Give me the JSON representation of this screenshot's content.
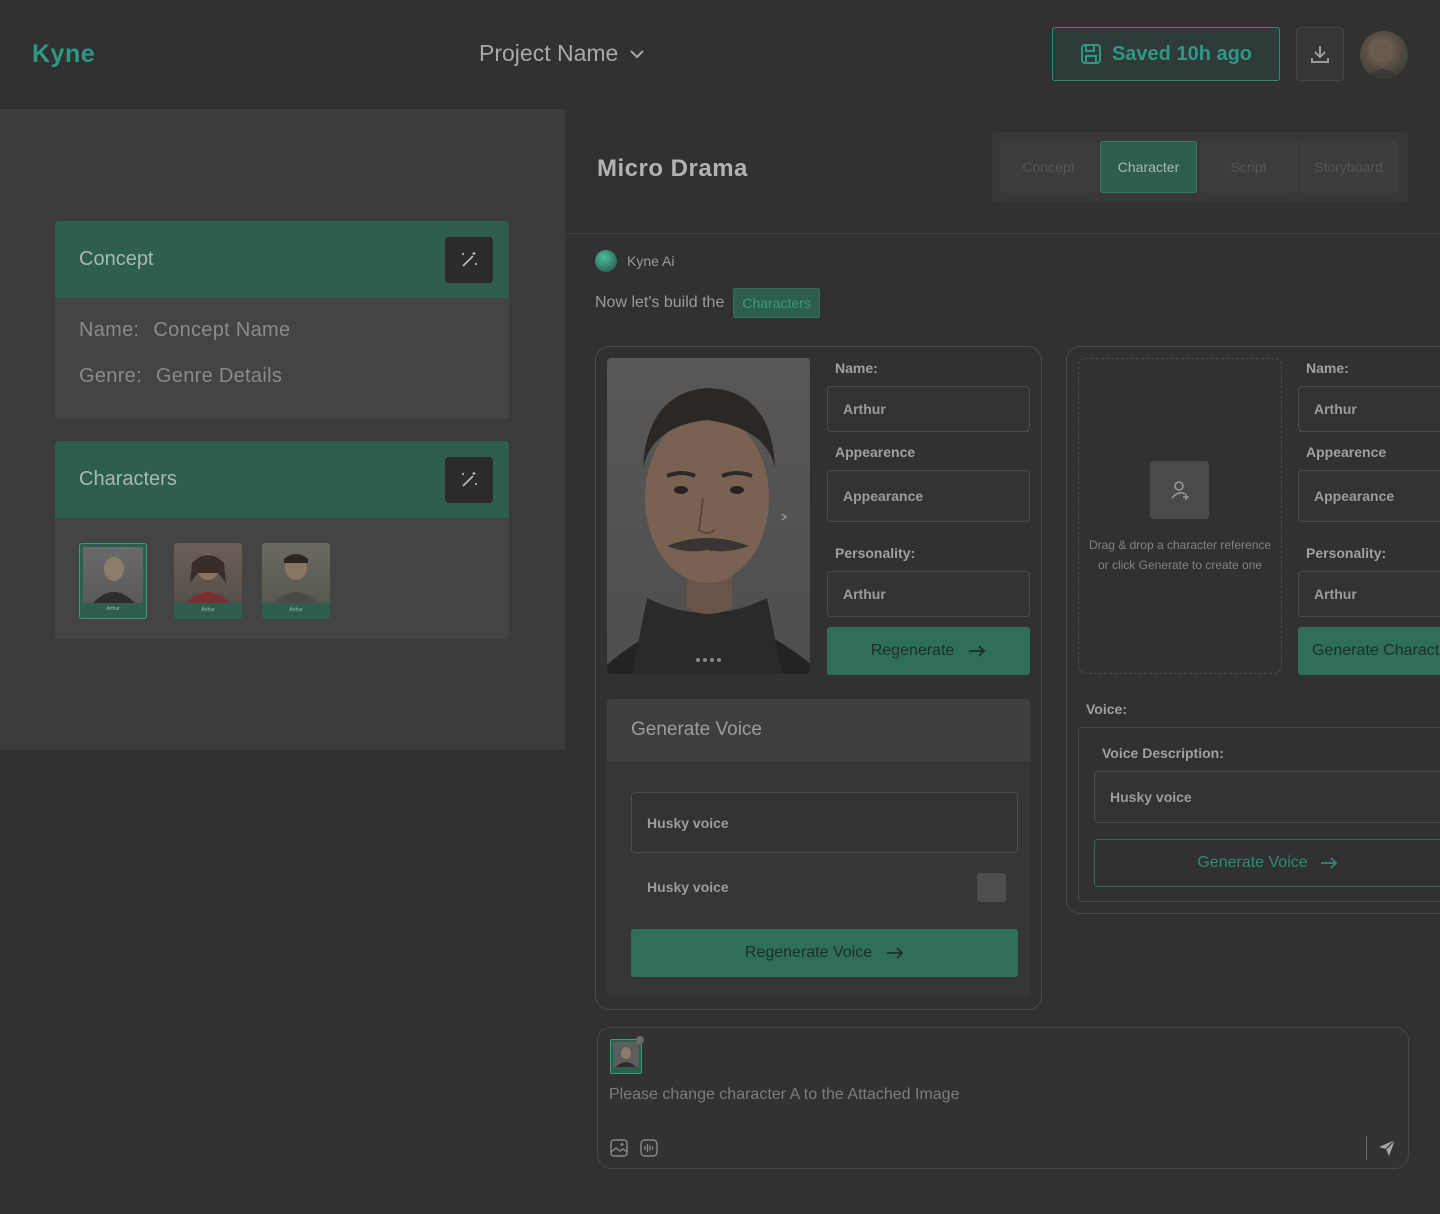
{
  "app": {
    "brand": "Kyne",
    "project_name": "Project Name",
    "saved_label": "Saved 10h ago"
  },
  "left": {
    "concept": {
      "title": "Concept",
      "name_label": "Name:",
      "name_value": "Concept Name",
      "genre_label": "Genre:",
      "genre_value": "Genre Details"
    },
    "characters": {
      "title": "Characters",
      "items": [
        {
          "label": "Arthur"
        },
        {
          "label": "Arthur"
        },
        {
          "label": "Arthur"
        }
      ]
    }
  },
  "main": {
    "title": "Micro Drama",
    "tabs": [
      {
        "label": "Concept"
      },
      {
        "label": "Character"
      },
      {
        "label": "Script"
      },
      {
        "label": "Storyboard"
      }
    ],
    "ai_name": "Kyne Ai",
    "build_text": "Now let's build the",
    "build_chip": "Characters"
  },
  "card1": {
    "name_label": "Name:",
    "name_value": "Arthur",
    "appearance_label": "Appearence",
    "appearance_value": "Appearance",
    "personality_label": "Personality:",
    "personality_value": "Arthur",
    "regenerate_label": "Regenerate",
    "voice": {
      "title": "Generate Voice",
      "description_value": "Husky voice",
      "option_value": "Husky voice",
      "button_label": "Regenerate Voice"
    }
  },
  "card2": {
    "drop_text_1": "Drag & drop a character reference",
    "drop_text_2": "or click Generate to create one",
    "name_label": "Name:",
    "name_value": "Arthur",
    "appearance_label": "Appearence",
    "appearance_value": "Appearance",
    "personality_label": "Personality:",
    "personality_value": "Arthur",
    "generate_label": "Generate Charact",
    "voice_label": "Voice:",
    "voice_desc_label": "Voice Description:",
    "voice_desc_value": "Husky voice",
    "generate_voice_label": "Generate Voice"
  },
  "chat": {
    "text": "Please change character A to the Attached Image"
  },
  "colors": {
    "accent": "#2f9884",
    "green_bg": "#2e5e4e",
    "page_bg": "#313131"
  },
  "icons": [
    "save-icon",
    "download-icon",
    "chevron-down-icon",
    "magic-wand-icon",
    "chevron-right-icon",
    "user-add-icon",
    "arrow-right-icon",
    "image-icon",
    "audio-wave-icon",
    "send-icon"
  ]
}
